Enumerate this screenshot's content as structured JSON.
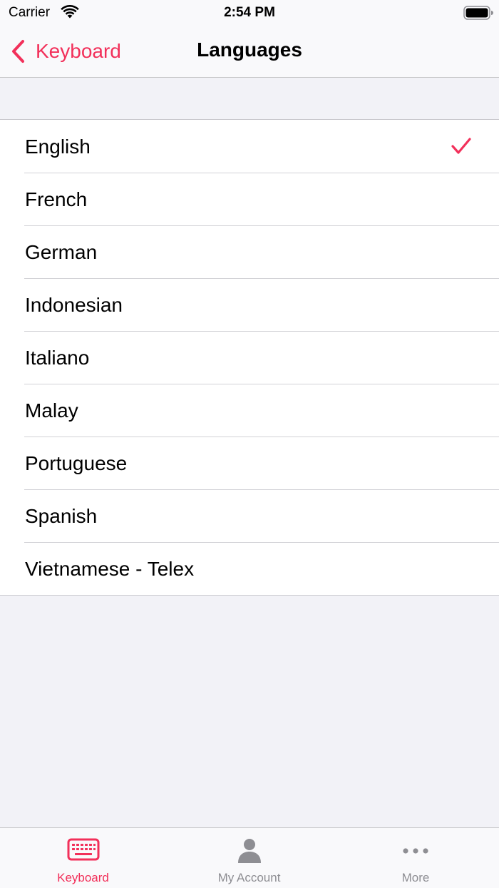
{
  "status_bar": {
    "carrier": "Carrier",
    "time": "2:54 PM"
  },
  "nav": {
    "back_label": "Keyboard",
    "title": "Languages"
  },
  "languages": {
    "selected": "English",
    "items": [
      {
        "label": "English",
        "checked": true
      },
      {
        "label": "French",
        "checked": false
      },
      {
        "label": "German",
        "checked": false
      },
      {
        "label": "Indonesian",
        "checked": false
      },
      {
        "label": "Italiano",
        "checked": false
      },
      {
        "label": "Malay",
        "checked": false
      },
      {
        "label": "Portuguese",
        "checked": false
      },
      {
        "label": "Spanish",
        "checked": false
      },
      {
        "label": "Vietnamese - Telex",
        "checked": false
      }
    ]
  },
  "tab_bar": {
    "tabs": [
      {
        "label": "Keyboard",
        "icon": "keyboard-icon",
        "active": true
      },
      {
        "label": "My Account",
        "icon": "person-icon",
        "active": false
      },
      {
        "label": "More",
        "icon": "ellipsis-icon",
        "active": false
      }
    ]
  },
  "colors": {
    "accent": "#f2305a",
    "inactive": "#8e8e93",
    "background": "#f2f2f7"
  }
}
